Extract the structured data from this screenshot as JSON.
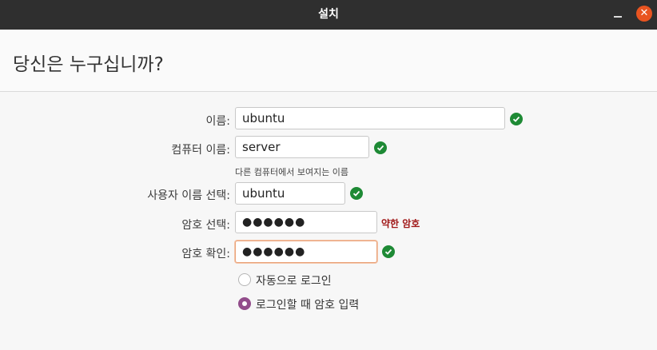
{
  "window": {
    "title": "설치",
    "minimize_label": "",
    "close_label": "✕"
  },
  "page": {
    "title": "당신은 누구십니까?"
  },
  "form": {
    "name_label": "이름:",
    "name_value": "ubuntu",
    "computer_label": "컴퓨터 이름:",
    "computer_value": "server",
    "computer_hint": "다른 컴퓨터에서 보여지는 이름",
    "username_label": "사용자 이름 선택:",
    "username_value": "ubuntu",
    "password_label": "암호 선택:",
    "password_value": "●●●●●●",
    "password_strength": "약한 암호",
    "confirm_label": "암호 확인:",
    "confirm_value": "●●●●●●"
  },
  "login_options": {
    "auto_login_label": "자동으로 로그인",
    "auto_login_selected": false,
    "require_password_label": "로그인할 때 암호 입력",
    "require_password_selected": true
  },
  "colors": {
    "titlebar": "#2f2f2f",
    "close_button": "#e95420",
    "valid_check": "#1e8a35",
    "weak_password": "#a01818",
    "radio_selected": "#924d8b"
  },
  "icons": [
    "check-icon",
    "close-icon",
    "minimize-icon"
  ]
}
